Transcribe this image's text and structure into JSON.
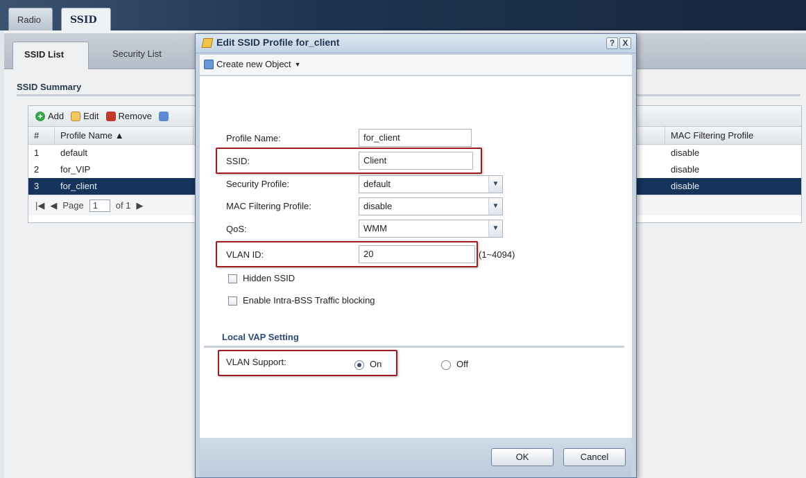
{
  "main_tabs": [
    {
      "label": "Radio"
    },
    {
      "label": "SSID",
      "active": true
    }
  ],
  "sub_tabs": [
    {
      "label": "SSID List",
      "active": true
    },
    {
      "label": "Security List"
    }
  ],
  "summary": {
    "title": "SSID Summary",
    "toolbar": {
      "add": "Add",
      "edit": "Edit",
      "remove": "Remove"
    },
    "columns": [
      "#",
      "Profile Name ▲",
      "MAC Filtering Profile"
    ],
    "rows": [
      {
        "idx": "1",
        "name": "default",
        "mac": "disable"
      },
      {
        "idx": "2",
        "name": "for_VIP",
        "mac": "disable"
      },
      {
        "idx": "3",
        "name": "for_client",
        "mac": "disable",
        "selected": true
      }
    ],
    "pager": {
      "page_label": "Page",
      "page_value": "1",
      "of_label": "of 1"
    }
  },
  "dialog": {
    "title": "Edit SSID Profile for_client",
    "help": "?",
    "close": "X",
    "menu_label": "Create new Object",
    "fields": {
      "profile_name": {
        "label": "Profile Name:",
        "value": "for_client"
      },
      "ssid": {
        "label": "SSID:",
        "value": "Client"
      },
      "security_profile": {
        "label": "Security Profile:",
        "value": "default"
      },
      "mac_filtering": {
        "label": "MAC Filtering Profile:",
        "value": "disable"
      },
      "qos": {
        "label": "QoS:",
        "value": "WMM"
      },
      "vlan_id": {
        "label": "VLAN ID:",
        "value": "20",
        "range": "(1~4094)"
      }
    },
    "checkboxes": {
      "hidden_ssid": {
        "label": "Hidden SSID",
        "checked": false
      },
      "intra_bss": {
        "label": "Enable Intra-BSS Traffic blocking",
        "checked": false
      }
    },
    "local_vap": {
      "title": "Local VAP Setting",
      "vlan_support_label": "VLAN Support:",
      "on_label": "On",
      "off_label": "Off",
      "selected": "On"
    },
    "buttons": {
      "ok": "OK",
      "cancel": "Cancel"
    }
  },
  "colors": {
    "highlight": "#a01c1c",
    "selected_row": "#16335c",
    "title_text": "#1d3350"
  }
}
